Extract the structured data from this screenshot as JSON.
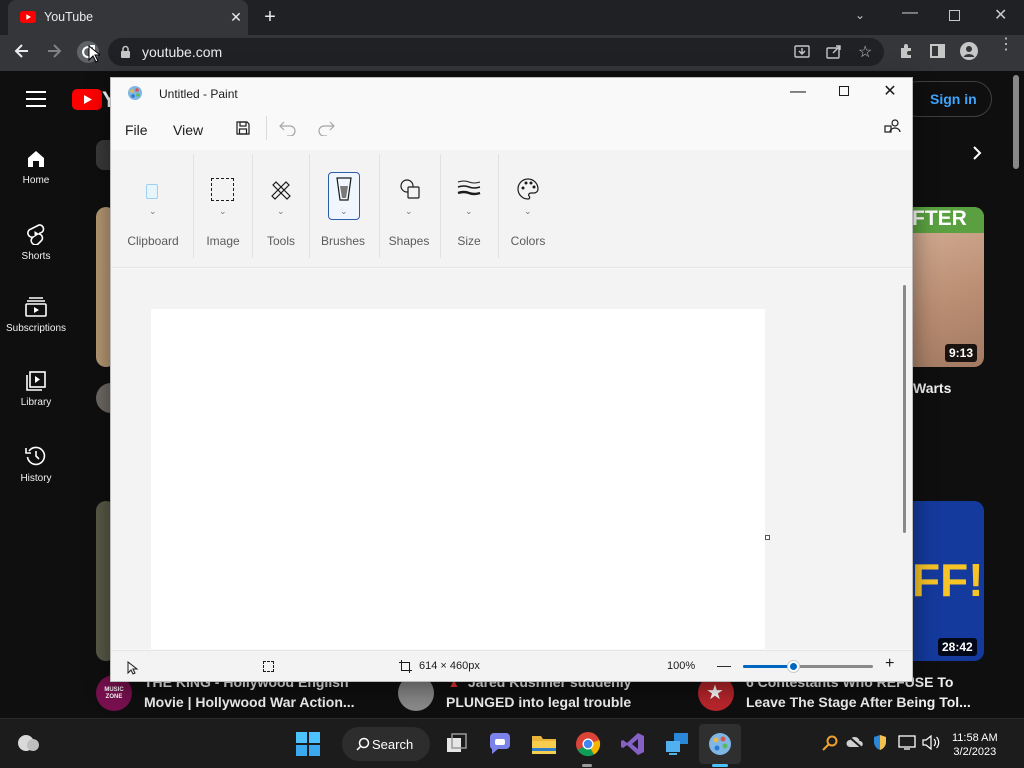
{
  "browser": {
    "tab_title": "YouTube",
    "url": "youtube.com"
  },
  "youtube": {
    "sign_in": "Sign in",
    "nav": [
      {
        "label": "Home",
        "icon": "home-icon"
      },
      {
        "label": "Shorts",
        "icon": "shorts-icon"
      },
      {
        "label": "Subscriptions",
        "icon": "subscriptions-icon"
      },
      {
        "label": "Library",
        "icon": "library-icon"
      },
      {
        "label": "History",
        "icon": "history-icon"
      }
    ],
    "thumb_text_1": "FTER",
    "thumb_text_2": "FF!",
    "durations": [
      "9:13",
      "28:42"
    ],
    "partial_title": "Warts",
    "videos": [
      {
        "line1": "THE KING - Hollywood English",
        "line2": "Movie | Hollywood War Action..."
      },
      {
        "line1": "Jared Kushner suddenly",
        "line2": "PLUNGED into legal trouble"
      },
      {
        "line1": "6 Contestants Who REFUSE To",
        "line2": "Leave The Stage After Being Tol..."
      }
    ],
    "channel_avatar_text": "MUSIC ZONE"
  },
  "paint": {
    "title": "Untitled - Paint",
    "menu": {
      "file": "File",
      "view": "View"
    },
    "ribbon_groups": [
      "Clipboard",
      "Image",
      "Tools",
      "Brushes",
      "Shapes",
      "Size",
      "Colors"
    ],
    "canvas_size": "614 × 460px",
    "zoom": "100%",
    "zoom_level": 0.4
  },
  "taskbar": {
    "search_label": "Search",
    "time": "11:58 AM",
    "date": "3/2/2023"
  },
  "colors": {
    "youtube_red": "#ff0000",
    "sign_in_blue": "#3ea6ff",
    "win_accent": "#0067c0"
  }
}
